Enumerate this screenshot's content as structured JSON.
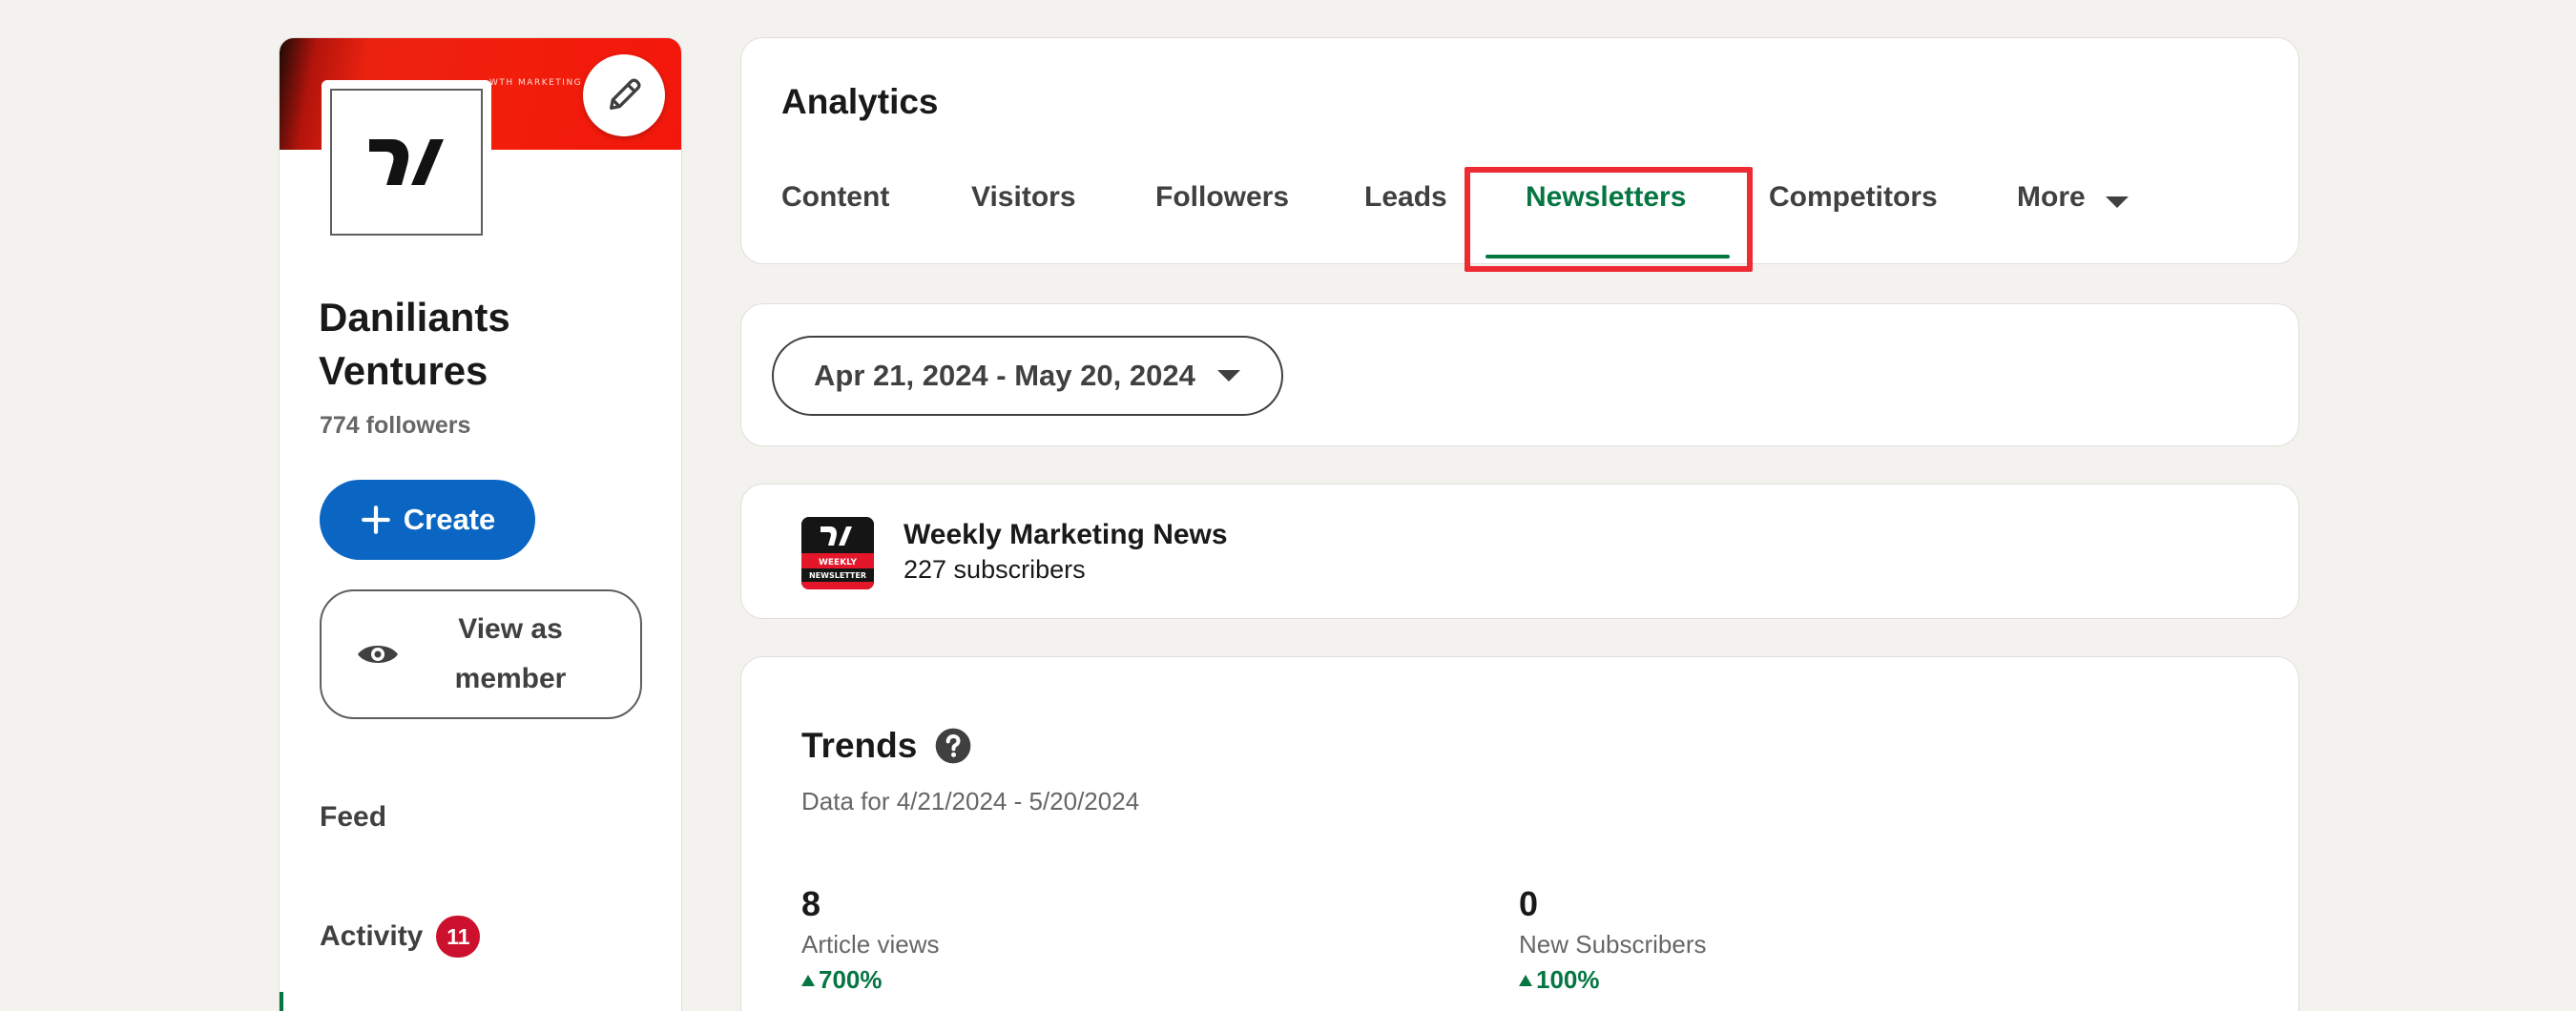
{
  "sidebar": {
    "cover_tagline": "WTH MARKETING A",
    "company_name": "Daniliants Ventures",
    "followers": "774 followers",
    "create_label": "Create",
    "view_as_member_label": "View as member",
    "nav": {
      "feed": "Feed",
      "activity": "Activity",
      "activity_badge": "11"
    }
  },
  "analytics": {
    "title": "Analytics",
    "tabs": [
      {
        "label": "Content"
      },
      {
        "label": "Visitors"
      },
      {
        "label": "Followers"
      },
      {
        "label": "Leads"
      },
      {
        "label": "Newsletters",
        "active": true
      },
      {
        "label": "Competitors"
      },
      {
        "label": "More"
      }
    ]
  },
  "date_range": {
    "label": "Apr 21, 2024 - May 20, 2024"
  },
  "newsletter": {
    "thumb_line1": "WEEKLY",
    "thumb_line2": "NEWSLETTER",
    "title": "Weekly Marketing News",
    "subscribers": "227 subscribers"
  },
  "trends": {
    "title": "Trends",
    "subtitle": "Data for 4/21/2024 - 5/20/2024",
    "metrics": [
      {
        "value": "8",
        "label": "Article views",
        "change": "700%"
      },
      {
        "value": "0",
        "label": "New Subscribers",
        "change": "100%"
      }
    ]
  },
  "colors": {
    "accent_green": "#057642",
    "primary_blue": "#0a66c2",
    "badge_red": "#cb112d",
    "highlight_red": "#ee2a33",
    "cover_red": "#f21d0b"
  },
  "icons": {
    "edit": "pencil-icon",
    "create": "plus-icon",
    "view_member": "eye-icon",
    "tab_more": "caret-down-icon",
    "date": "caret-down-icon",
    "trends_help": "question-circle-icon",
    "change": "triangle-up-icon"
  }
}
